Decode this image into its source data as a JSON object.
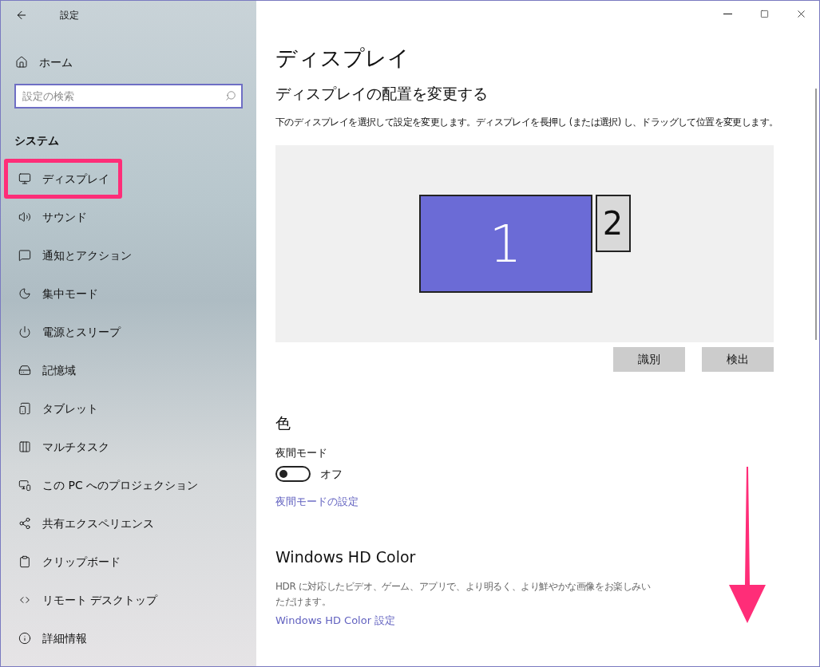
{
  "window": {
    "title": "設定"
  },
  "sidebar": {
    "home": "ホーム",
    "search": {
      "placeholder": "設定の検索"
    },
    "section": "システム",
    "items": [
      {
        "kind": "display",
        "label": "ディスプレイ",
        "selected": true
      },
      {
        "kind": "sound",
        "label": "サウンド",
        "selected": false
      },
      {
        "kind": "notifications",
        "label": "通知とアクション",
        "selected": false
      },
      {
        "kind": "focus",
        "label": "集中モード",
        "selected": false
      },
      {
        "kind": "power",
        "label": "電源とスリープ",
        "selected": false
      },
      {
        "kind": "storage",
        "label": "記憶域",
        "selected": false
      },
      {
        "kind": "tablet",
        "label": "タブレット",
        "selected": false
      },
      {
        "kind": "multitask",
        "label": "マルチタスク",
        "selected": false
      },
      {
        "kind": "projection",
        "label": "この PC へのプロジェクション",
        "selected": false
      },
      {
        "kind": "sharing",
        "label": "共有エクスペリエンス",
        "selected": false
      },
      {
        "kind": "clipboard",
        "label": "クリップボード",
        "selected": false
      },
      {
        "kind": "remote",
        "label": "リモート デスクトップ",
        "selected": false
      },
      {
        "kind": "about",
        "label": "詳細情報",
        "selected": false
      }
    ]
  },
  "main": {
    "title": "ディスプレイ",
    "arrangement": {
      "heading": "ディスプレイの配置を変更する",
      "description": "下のディスプレイを選択して設定を変更します。ディスプレイを長押し (または選択) し、ドラッグして位置を変更します。",
      "displays": [
        {
          "label": "1",
          "selected": true
        },
        {
          "label": "2",
          "selected": false
        }
      ],
      "buttons": [
        "識別",
        "検出"
      ]
    },
    "color": {
      "heading": "色",
      "night_mode": {
        "label": "夜間モード",
        "on": false,
        "state": "オフ"
      },
      "link": "夜間モードの設定"
    },
    "hd_color": {
      "heading": "Windows HD Color",
      "description": "HDR に対応したビデオ、ゲーム、アプリで、より明るく、より鮮やかな画像をお楽しみいただけます。",
      "link": "Windows HD Color 設定"
    }
  }
}
